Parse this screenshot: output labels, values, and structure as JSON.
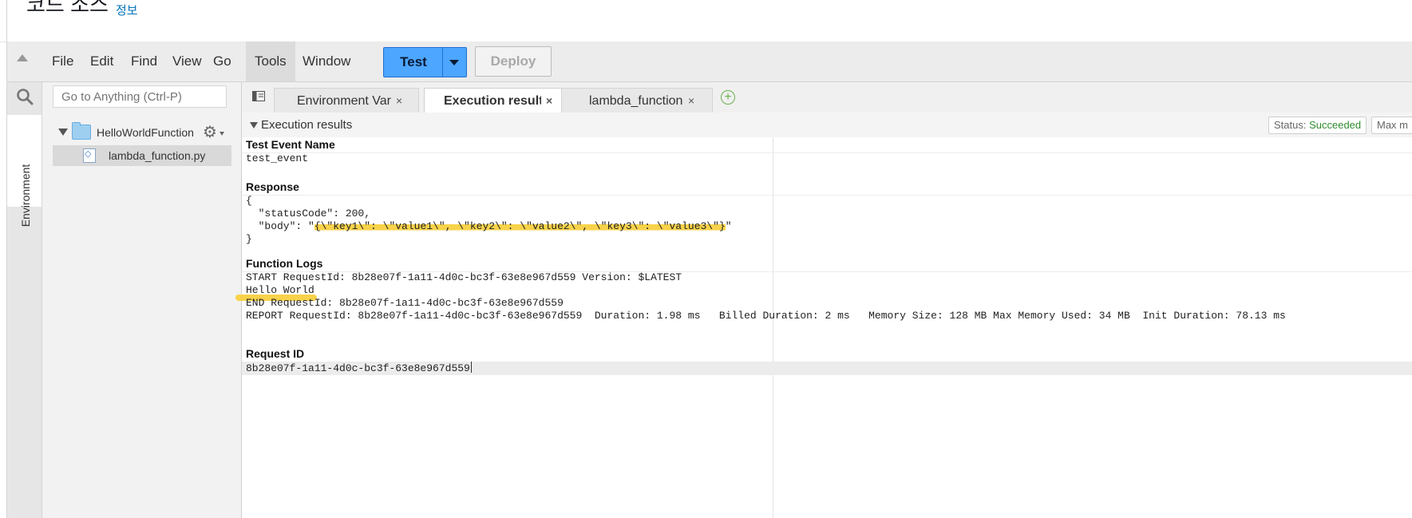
{
  "header": {
    "title": "코드 소스",
    "info_link": "정보"
  },
  "menubar": {
    "items": [
      "File",
      "Edit",
      "Find",
      "View",
      "Go",
      "Tools",
      "Window"
    ],
    "test_label": "Test",
    "deploy_label": "Deploy"
  },
  "sidebar": {
    "goto_placeholder": "Go to Anything (Ctrl-P)",
    "env_tab": "Environment",
    "folder": "HelloWorldFunction",
    "file": "lambda_function.py"
  },
  "tabs": [
    {
      "label": "Environment Vari",
      "close": "×"
    },
    {
      "label": "Execution results",
      "close": "×"
    },
    {
      "label": "lambda_function",
      "close": "×"
    }
  ],
  "results": {
    "header": "Execution results",
    "status_label": "Status: ",
    "status_value": "Succeeded",
    "max_mem_label": "Max m",
    "test_event_title": "Test Event Name",
    "test_event_value": "test_event",
    "response_title": "Response",
    "response_lines": [
      "{",
      "  \"statusCode\": 200,",
      "  \"body\": \"",
      "{\\\"key1\\\": \\\"value1\\\", \\\"key2\\\": \\\"value2\\\", \\\"key3\\\": \\\"value3\\\"}",
      "\"",
      "}"
    ],
    "logs_title": "Function Logs",
    "log_lines": [
      "START RequestId: 8b28e07f-1a11-4d0c-bc3f-63e8e967d559 Version: $LATEST",
      "Hello World",
      "END RequestId: 8b28e07f-1a11-4d0c-bc3f-63e8e967d559",
      "REPORT RequestId: 8b28e07f-1a11-4d0c-bc3f-63e8e967d559  Duration: 1.98 ms   Billed Duration: 2 ms   Memory Size: 128 MB Max Memory Used: 34 MB  Init Duration: 78.13 ms"
    ],
    "request_id_title": "Request ID",
    "request_id_value": "8b28e07f-1a11-4d0c-bc3f-63e8e967d559"
  },
  "colors": {
    "test_button": "#4da6ff",
    "status_ok": "#2f8b2f",
    "highlight": "#f8d24a",
    "info_link": "#0073bb"
  }
}
